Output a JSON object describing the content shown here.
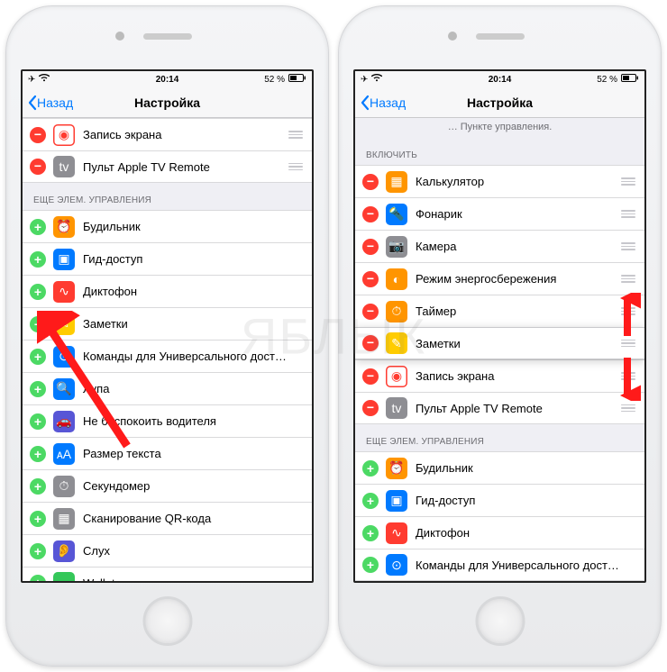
{
  "status": {
    "time": "20:14",
    "battery": "52 %"
  },
  "navbar": {
    "back": "Назад",
    "title": "Настройка"
  },
  "left": {
    "included_rows": [
      {
        "action": "remove",
        "iconBg": "#ffffff",
        "iconBorder": "#ff3b30",
        "glyph": "◉",
        "glyphColor": "#ff3b30",
        "label": "Запись экрана"
      },
      {
        "action": "remove",
        "iconBg": "#8e8e93",
        "glyph": "tv",
        "label": "Пульт Apple TV Remote"
      }
    ],
    "more_header": "ЕЩЕ ЭЛЕМ. УПРАВЛЕНИЯ",
    "more_rows": [
      {
        "action": "add",
        "iconBg": "#ff9500",
        "glyph": "⏰",
        "label": "Будильник"
      },
      {
        "action": "add",
        "iconBg": "#007aff",
        "glyph": "▣",
        "label": "Гид-доступ"
      },
      {
        "action": "add",
        "iconBg": "#ff3b30",
        "glyph": "∿",
        "label": "Диктофон"
      },
      {
        "action": "add",
        "iconBg": "#ffcc00",
        "glyph": "✎",
        "label": "Заметки"
      },
      {
        "action": "add",
        "iconBg": "#007aff",
        "glyph": "⊙",
        "label": "Команды для Универсального дост…"
      },
      {
        "action": "add",
        "iconBg": "#007aff",
        "glyph": "🔍",
        "label": "Лупа"
      },
      {
        "action": "add",
        "iconBg": "#5856d6",
        "glyph": "🚗",
        "label": "Не беспокоить водителя"
      },
      {
        "action": "add",
        "iconBg": "#007aff",
        "glyph": "ᴀA",
        "label": "Размер текста"
      },
      {
        "action": "add",
        "iconBg": "#8e8e93",
        "glyph": "⏱",
        "label": "Секундомер"
      },
      {
        "action": "add",
        "iconBg": "#8e8e93",
        "glyph": "▦",
        "label": "Сканирование QR-кода"
      },
      {
        "action": "add",
        "iconBg": "#5856d6",
        "glyph": "👂",
        "label": "Слух"
      },
      {
        "action": "add",
        "iconBg": "#34c759",
        "glyph": "▭",
        "label": "Wallet"
      }
    ]
  },
  "right": {
    "caption": "… Пункте управления.",
    "include_header": "ВКЛЮЧИТЬ",
    "included_rows": [
      {
        "action": "remove",
        "iconBg": "#ff9500",
        "glyph": "▦",
        "label": "Калькулятор"
      },
      {
        "action": "remove",
        "iconBg": "#007aff",
        "glyph": "🔦",
        "label": "Фонарик"
      },
      {
        "action": "remove",
        "iconBg": "#8e8e93",
        "glyph": "📷",
        "label": "Камера"
      },
      {
        "action": "remove",
        "iconBg": "#ff9500",
        "glyph": "◐",
        "label": "Режим энергосбережения"
      },
      {
        "action": "remove",
        "iconBg": "#ff9500",
        "glyph": "⏱",
        "label": "Таймер"
      },
      {
        "action": "remove",
        "iconBg": "#ffcc00",
        "glyph": "✎",
        "label": "Заметки",
        "dragging": true
      },
      {
        "action": "remove",
        "iconBg": "#ffffff",
        "iconBorder": "#ff3b30",
        "glyph": "◉",
        "glyphColor": "#ff3b30",
        "label": "Запись экрана"
      },
      {
        "action": "remove",
        "iconBg": "#8e8e93",
        "glyph": "tv",
        "label": "Пульт Apple TV Remote"
      }
    ],
    "more_header": "ЕЩЕ ЭЛЕМ. УПРАВЛЕНИЯ",
    "more_rows": [
      {
        "action": "add",
        "iconBg": "#ff9500",
        "glyph": "⏰",
        "label": "Будильник"
      },
      {
        "action": "add",
        "iconBg": "#007aff",
        "glyph": "▣",
        "label": "Гид-доступ"
      },
      {
        "action": "add",
        "iconBg": "#ff3b30",
        "glyph": "∿",
        "label": "Диктофон"
      },
      {
        "action": "add",
        "iconBg": "#007aff",
        "glyph": "⊙",
        "label": "Команды для Универсального дост…"
      }
    ]
  }
}
